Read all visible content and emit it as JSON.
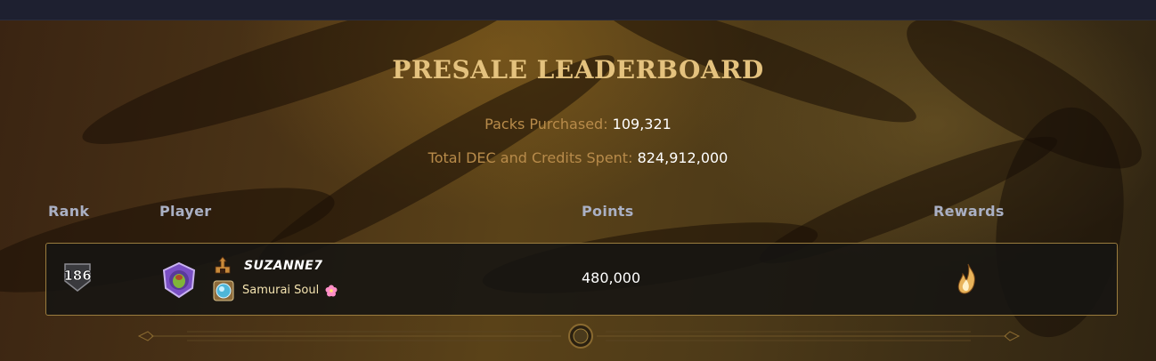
{
  "title": "PRESALE LEADERBOARD",
  "stats": {
    "packs_label": "Packs Purchased:",
    "packs_value": "109,321",
    "dec_label": "Total DEC and Credits Spent:",
    "dec_value": "824,912,000"
  },
  "columns": {
    "rank": "Rank",
    "player": "Player",
    "points": "Points",
    "rewards": "Rewards"
  },
  "rows": [
    {
      "rank": "186",
      "player_name": "SUZANNE7",
      "guild_name": "Samurai Soul",
      "points": "480,000",
      "reward_icon": "fire-reward-icon"
    }
  ],
  "colors": {
    "title": "#e4c27e",
    "label": "#b88b4a",
    "header": "#aab0c4",
    "row_border": "#9a7c3e",
    "topbar": "#1e2030"
  }
}
